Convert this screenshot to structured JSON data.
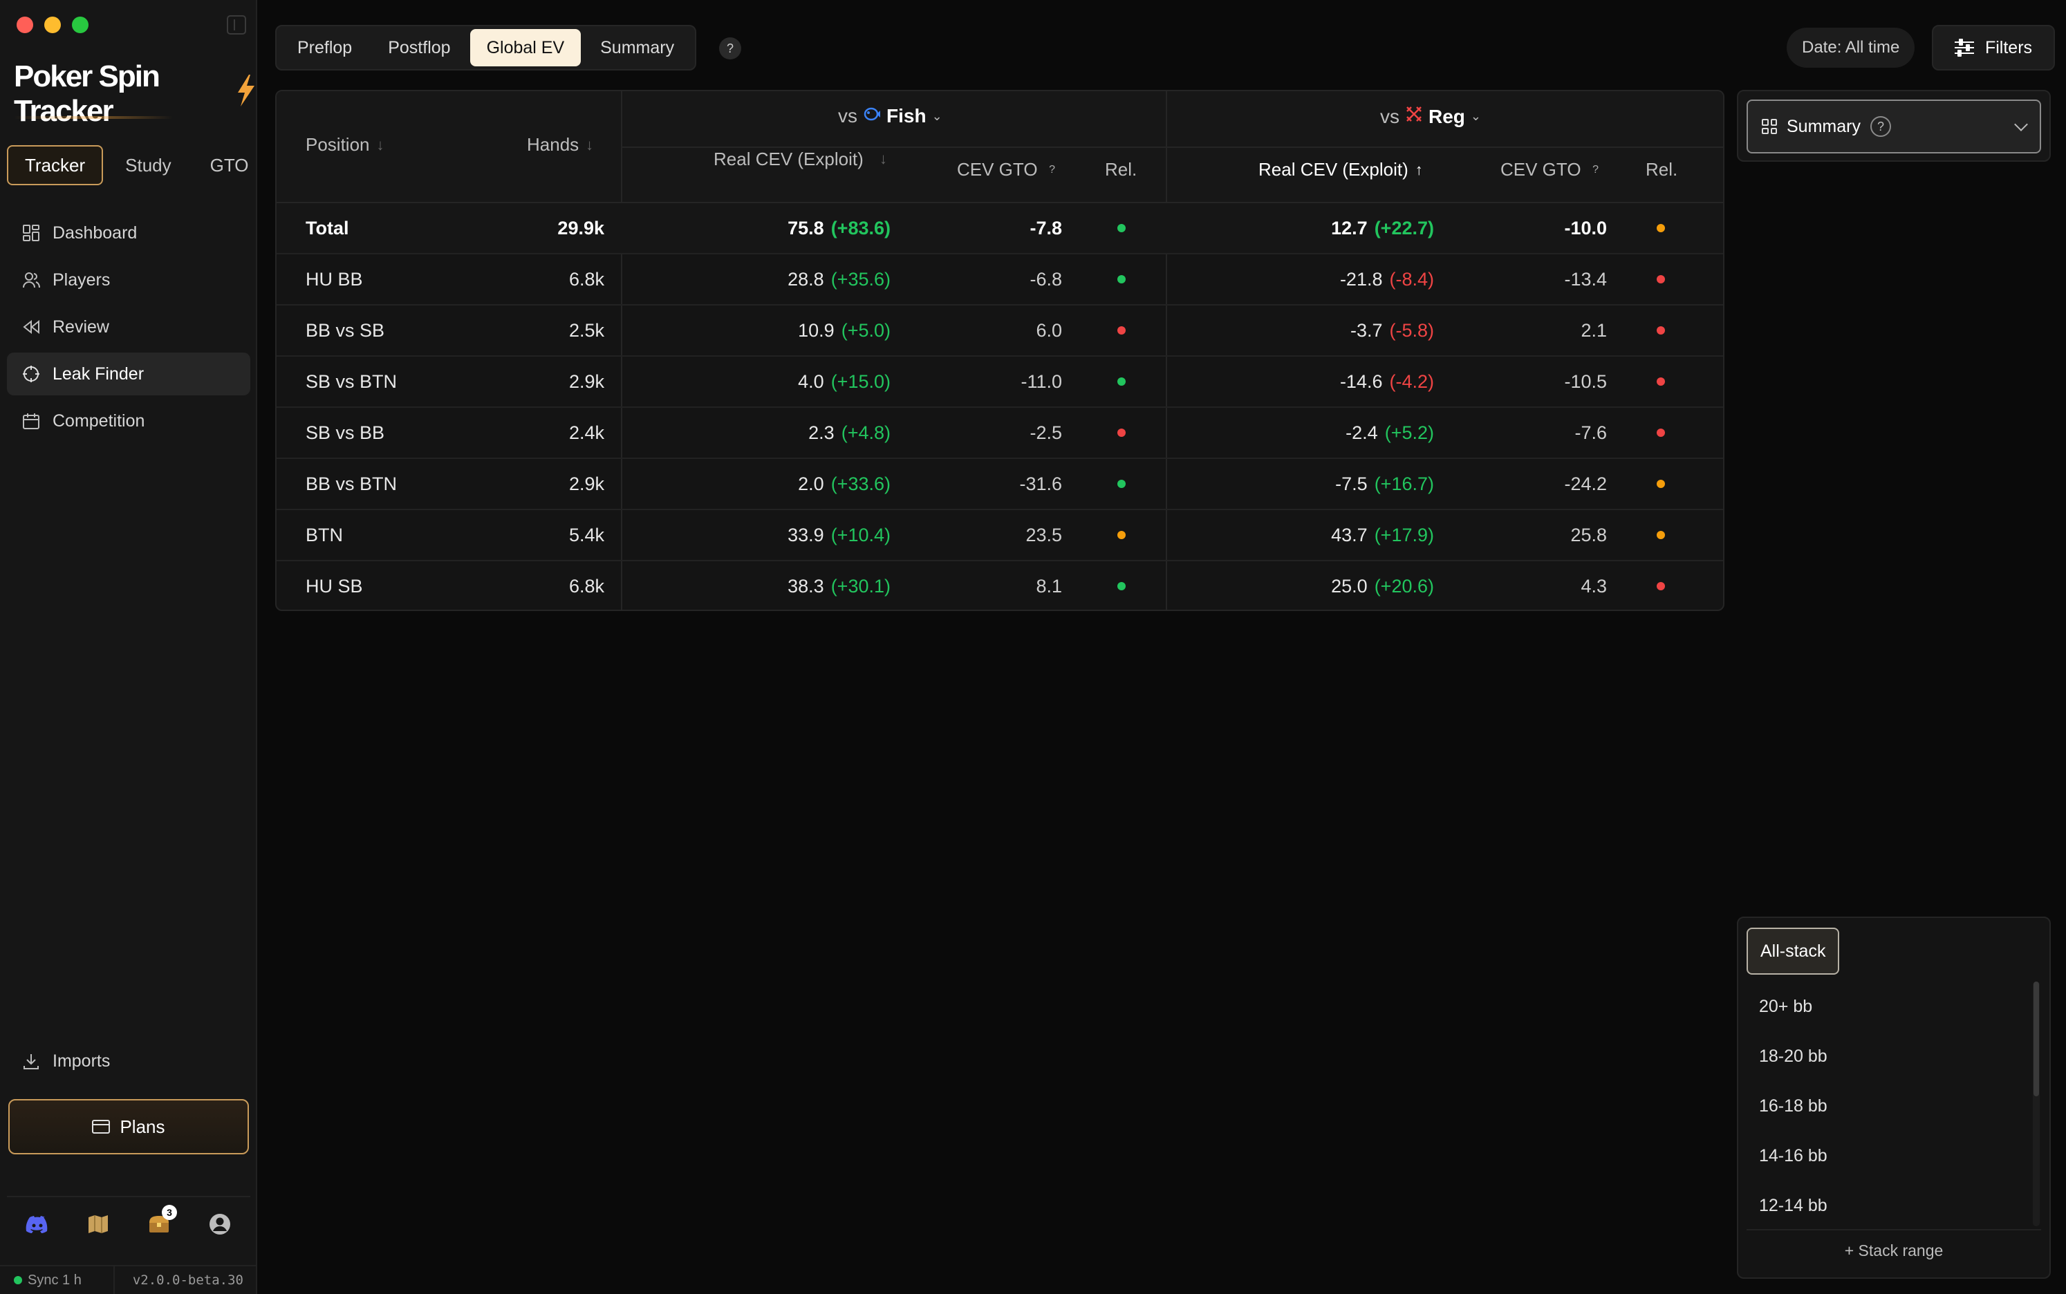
{
  "app": {
    "title": "Poker Spin Tracker",
    "accent": "#f2a23a"
  },
  "sidebar": {
    "modes": [
      {
        "label": "Tracker",
        "active": true
      },
      {
        "label": "Study",
        "active": false
      },
      {
        "label": "GTO",
        "active": false
      }
    ],
    "nav": [
      {
        "label": "Dashboard",
        "icon": "dashboard-icon"
      },
      {
        "label": "Players",
        "icon": "users-icon"
      },
      {
        "label": "Review",
        "icon": "rewind-icon"
      },
      {
        "label": "Leak Finder",
        "icon": "crosshair-icon",
        "active": true
      },
      {
        "label": "Competition",
        "icon": "calendar-icon"
      }
    ],
    "imports_label": "Imports",
    "plans_label": "Plans",
    "notification_count": "3",
    "sync_label": "Sync 1 h",
    "version": "v2.0.0-beta.30"
  },
  "topbar": {
    "tabs": [
      {
        "label": "Preflop",
        "active": false
      },
      {
        "label": "Postflop",
        "active": false
      },
      {
        "label": "Global EV",
        "active": true
      },
      {
        "label": "Summary",
        "active": false
      }
    ],
    "help": "?",
    "date_label": "Date: All time",
    "filters_label": "Filters"
  },
  "table": {
    "headers": {
      "position": "Position",
      "hands": "Hands",
      "group_fish_prefix": "vs",
      "group_fish": "Fish",
      "group_reg_prefix": "vs",
      "group_reg": "Reg",
      "real_cev": "Real CEV (Exploit)",
      "cev_gto": "CEV GTO",
      "rel": "Rel.",
      "q": "?"
    },
    "rows": [
      {
        "position": "Total",
        "hands": "29.9k",
        "fish_cev": "75.8",
        "fish_delta": "(+83.6)",
        "fish_delta_sign": "pos",
        "fish_gto": "-7.8",
        "fish_rel": "green",
        "reg_cev": "12.7",
        "reg_delta": "(+22.7)",
        "reg_delta_sign": "pos",
        "reg_gto": "-10.0",
        "reg_rel": "orange",
        "total": true
      },
      {
        "position": "HU BB",
        "hands": "6.8k",
        "fish_cev": "28.8",
        "fish_delta": "(+35.6)",
        "fish_delta_sign": "pos",
        "fish_gto": "-6.8",
        "fish_rel": "green",
        "reg_cev": "-21.8",
        "reg_delta": "(-8.4)",
        "reg_delta_sign": "neg",
        "reg_gto": "-13.4",
        "reg_rel": "red"
      },
      {
        "position": "BB vs SB",
        "hands": "2.5k",
        "fish_cev": "10.9",
        "fish_delta": "(+5.0)",
        "fish_delta_sign": "pos",
        "fish_gto": "6.0",
        "fish_rel": "red",
        "reg_cev": "-3.7",
        "reg_delta": "(-5.8)",
        "reg_delta_sign": "neg",
        "reg_gto": "2.1",
        "reg_rel": "red"
      },
      {
        "position": "SB vs BTN",
        "hands": "2.9k",
        "fish_cev": "4.0",
        "fish_delta": "(+15.0)",
        "fish_delta_sign": "pos",
        "fish_gto": "-11.0",
        "fish_rel": "green",
        "reg_cev": "-14.6",
        "reg_delta": "(-4.2)",
        "reg_delta_sign": "neg",
        "reg_gto": "-10.5",
        "reg_rel": "red"
      },
      {
        "position": "SB vs BB",
        "hands": "2.4k",
        "fish_cev": "2.3",
        "fish_delta": "(+4.8)",
        "fish_delta_sign": "pos",
        "fish_gto": "-2.5",
        "fish_rel": "red",
        "reg_cev": "-2.4",
        "reg_delta": "(+5.2)",
        "reg_delta_sign": "pos",
        "reg_gto": "-7.6",
        "reg_rel": "red"
      },
      {
        "position": "BB vs BTN",
        "hands": "2.9k",
        "fish_cev": "2.0",
        "fish_delta": "(+33.6)",
        "fish_delta_sign": "pos",
        "fish_gto": "-31.6",
        "fish_rel": "green",
        "reg_cev": "-7.5",
        "reg_delta": "(+16.7)",
        "reg_delta_sign": "pos",
        "reg_gto": "-24.2",
        "reg_rel": "orange"
      },
      {
        "position": "BTN",
        "hands": "5.4k",
        "fish_cev": "33.9",
        "fish_delta": "(+10.4)",
        "fish_delta_sign": "pos",
        "fish_gto": "23.5",
        "fish_rel": "orange",
        "reg_cev": "43.7",
        "reg_delta": "(+17.9)",
        "reg_delta_sign": "pos",
        "reg_gto": "25.8",
        "reg_rel": "orange"
      },
      {
        "position": "HU SB",
        "hands": "6.8k",
        "fish_cev": "38.3",
        "fish_delta": "(+30.1)",
        "fish_delta_sign": "pos",
        "fish_gto": "8.1",
        "fish_rel": "green",
        "reg_cev": "25.0",
        "reg_delta": "(+20.6)",
        "reg_delta_sign": "pos",
        "reg_gto": "4.3",
        "reg_rel": "red"
      }
    ]
  },
  "colors": {
    "green": "#22c55e",
    "red": "#ef4444",
    "orange": "#f59e0b"
  },
  "summary_panel": {
    "selected": "Summary",
    "help": "?"
  },
  "stack_panel": {
    "active": "All-stack",
    "items": [
      "20+ bb",
      "18-20 bb",
      "16-18 bb",
      "14-16 bb",
      "12-14 bb"
    ],
    "add_label": "+ Stack range"
  }
}
